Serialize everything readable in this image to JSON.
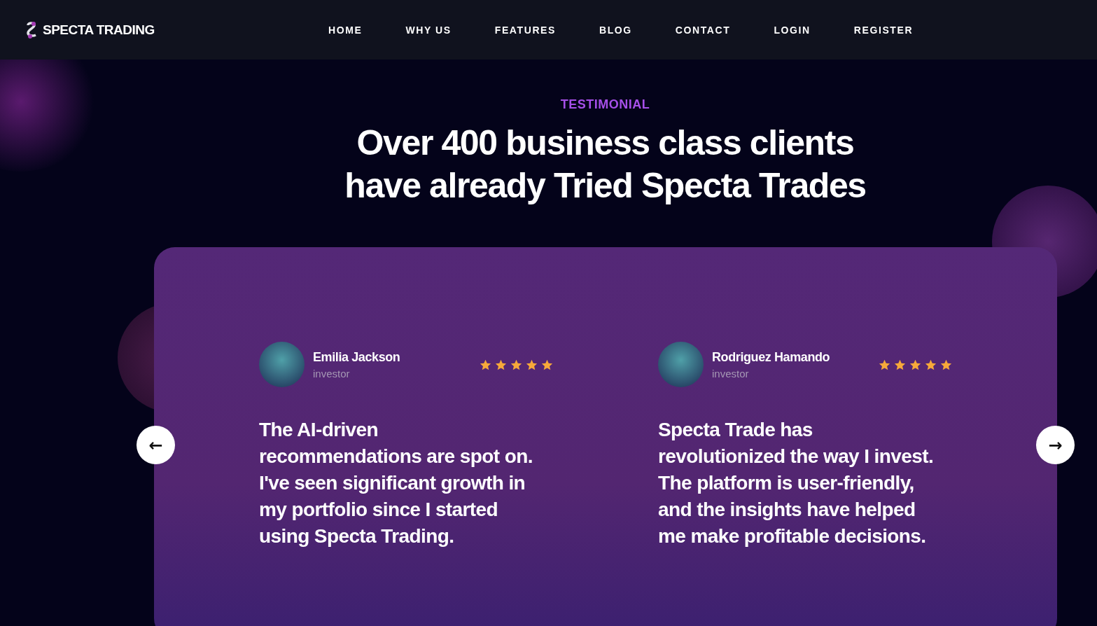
{
  "header": {
    "logo": "SPECTA TRADING",
    "nav": [
      "HOME",
      "WHY US",
      "FEATURES",
      "BLOG",
      "CONTACT",
      "LOGIN",
      "REGISTER"
    ]
  },
  "section": {
    "eyebrow": "TESTIMONIAL",
    "title_lines": [
      "Over 400 business class clients",
      "have already Tried Specta Trades"
    ]
  },
  "testimonials": [
    {
      "name": "Emilia Jackson",
      "role": "investor",
      "stars": 5,
      "quote": "The AI-driven recommendations are spot on. I've seen significant growth in my portfolio since I started using Specta Trading."
    },
    {
      "name": "Rodriguez Hamando",
      "role": "investor",
      "stars": 5,
      "quote": "Specta Trade has revolutionized the way I invest. The platform is user-friendly, and the insights have helped me make profitable decisions."
    }
  ],
  "carousel": {
    "prev": "←",
    "next": "→"
  }
}
